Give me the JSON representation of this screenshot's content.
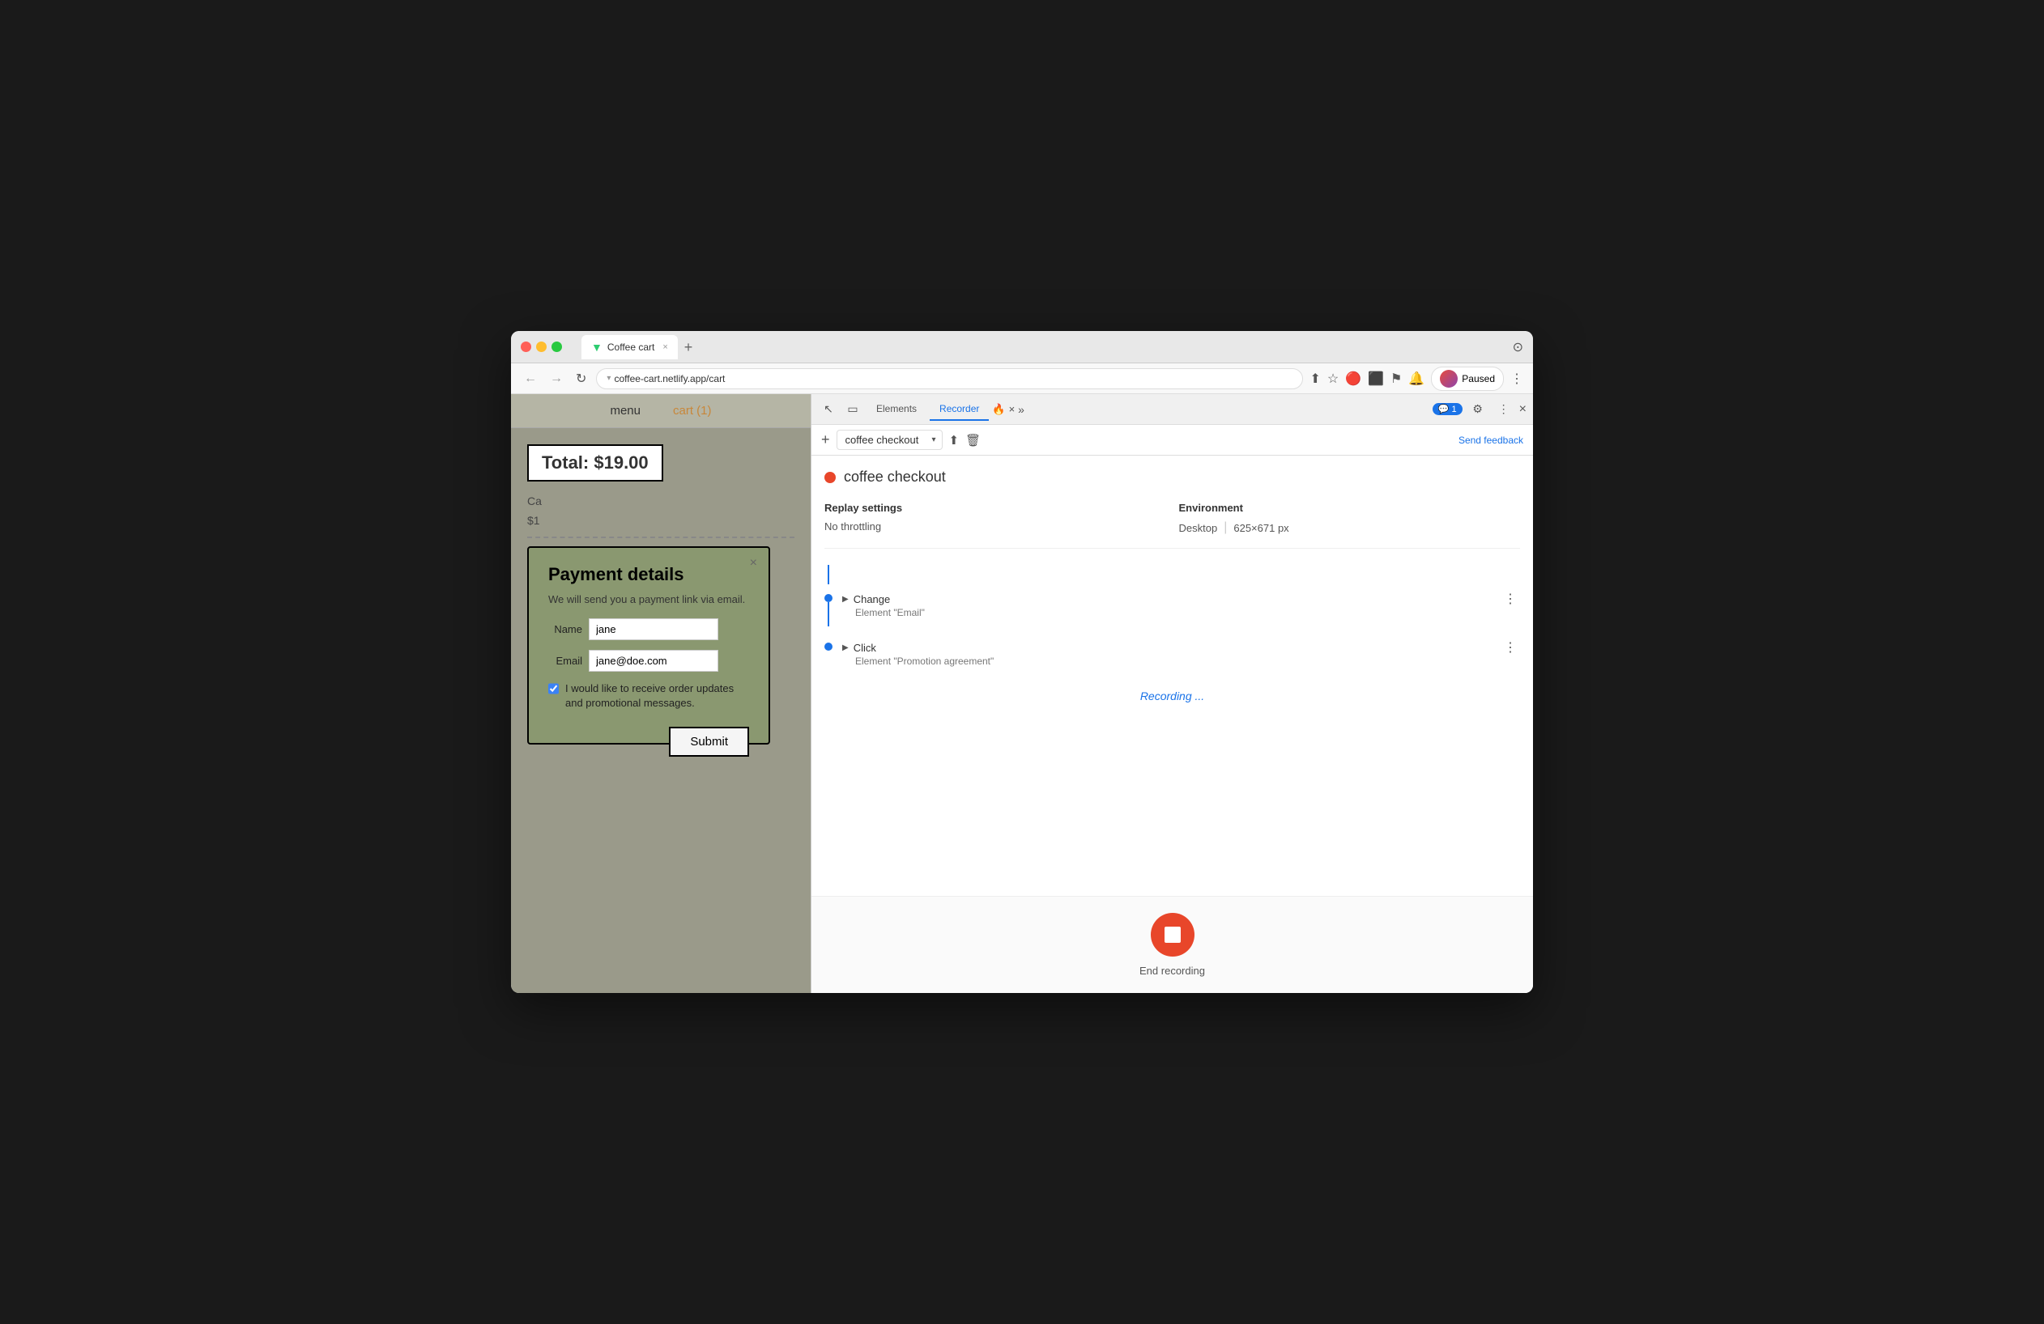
{
  "browser": {
    "tab_title": "Coffee cart",
    "tab_favicon": "▼",
    "url": "coffee-cart.netlify.app/cart",
    "new_tab_label": "+",
    "paused_label": "Paused"
  },
  "nav": {
    "menu_label": "menu",
    "cart_label": "cart (1)"
  },
  "page": {
    "total_label": "Total: $19.00",
    "cart_item": "Ca",
    "cart_price": "$1",
    "payment_modal": {
      "title": "Payment details",
      "subtitle": "We will send you a payment link via email.",
      "name_label": "Name",
      "name_value": "jane",
      "email_label": "Email",
      "email_value": "jane@doe.com",
      "checkbox_label": "I would like to receive order updates and promotional messages.",
      "submit_label": "Submit",
      "close_label": "×"
    }
  },
  "devtools": {
    "tabs": {
      "elements_label": "Elements",
      "recorder_label": "Recorder",
      "chat_badge": "1"
    },
    "toolbar": {
      "add_label": "+",
      "recording_name": "coffee checkout",
      "send_feedback_label": "Send feedback"
    },
    "recording_title": "coffee checkout",
    "replay_settings": {
      "heading": "Replay settings",
      "throttling_label": "No throttling",
      "env_heading": "Environment",
      "env_value": "Desktop",
      "env_size": "625×671 px"
    },
    "steps": [
      {
        "action": "Change",
        "detail": "Element \"Email\""
      },
      {
        "action": "Click",
        "detail": "Element \"Promotion agreement\""
      }
    ],
    "recording_status": "Recording ...",
    "end_recording_label": "End recording"
  }
}
